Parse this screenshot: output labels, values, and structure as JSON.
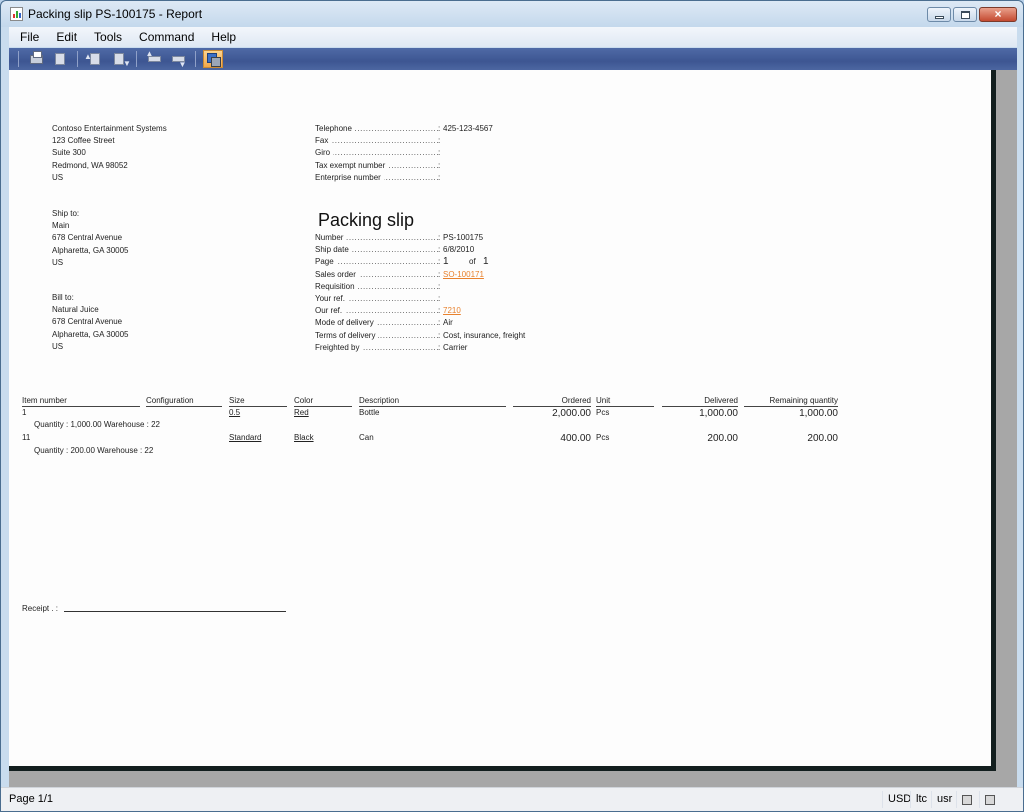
{
  "window": {
    "title": "Packing slip PS-100175 - Report",
    "controls": {
      "minimize": "minimize",
      "maximize": "maximize",
      "close": "×"
    }
  },
  "menubar": {
    "items": [
      "File",
      "Edit",
      "Tools",
      "Command",
      "Help"
    ]
  },
  "toolbar": {
    "buttons": [
      {
        "icon": "printer-icon",
        "tooltip": "Print"
      },
      {
        "icon": "export-icon",
        "tooltip": "Export"
      },
      {
        "icon": "page-up-icon",
        "tooltip": "Previous"
      },
      {
        "icon": "page-down-icon",
        "tooltip": "Next"
      },
      {
        "icon": "first-page-icon",
        "tooltip": "First"
      },
      {
        "icon": "last-page-icon",
        "tooltip": "Last"
      },
      {
        "icon": "view-toggle-icon",
        "tooltip": "Toggle view",
        "active": true
      }
    ]
  },
  "report": {
    "company": {
      "lines": [
        "Contoso Entertainment Systems",
        "123 Coffee Street",
        "Suite 300",
        "Redmond, WA 98052",
        "US"
      ]
    },
    "contact": [
      {
        "label": "Telephone",
        "value": "425-123-4567"
      },
      {
        "label": "Fax",
        "value": ""
      },
      {
        "label": "Giro",
        "value": ""
      },
      {
        "label": "Tax exempt number",
        "value": ""
      },
      {
        "label": "Enterprise number",
        "value": ""
      }
    ],
    "ship_to": {
      "lines": [
        "Ship to:",
        "Main",
        "678 Central Avenue",
        "Alpharetta, GA 30005",
        "US"
      ]
    },
    "bill_to": {
      "lines": [
        "Bill to:",
        "Natural Juice",
        "678 Central Avenue",
        "Alpharetta, GA 30005",
        "US"
      ]
    },
    "title": "Packing slip",
    "details": [
      {
        "label": "Number",
        "value": "PS-100175"
      },
      {
        "label": "Ship date",
        "value": "6/8/2010"
      },
      {
        "label": "Page",
        "value": "1",
        "of_label": "of",
        "of_value": "1"
      },
      {
        "label": "Sales order",
        "value": "SO-100171",
        "link": true
      },
      {
        "label": "Requisition",
        "value": ""
      },
      {
        "label": "Your ref.",
        "value": ""
      },
      {
        "label": "Our ref.",
        "value": "7210",
        "link": true
      },
      {
        "label": "Mode of delivery",
        "value": "Air"
      },
      {
        "label": "Terms of delivery",
        "value": "Cost, insurance, freight"
      },
      {
        "label": "Freighted by",
        "value": "Carrier"
      }
    ],
    "dots": "................................................",
    "colon": ":",
    "table": {
      "headers": {
        "item_number": "Item number",
        "configuration": "Configuration",
        "size": "Size",
        "color": "Color",
        "description": "Description",
        "ordered": "Ordered",
        "unit": "Unit",
        "delivered": "Delivered",
        "remaining": "Remaining quantity"
      },
      "rows": [
        {
          "item_number": "1",
          "configuration": "",
          "size": "0.5",
          "color": "Red",
          "description": "Bottle",
          "ordered": "2,000.00",
          "unit": "Pcs",
          "delivered": "1,000.00",
          "remaining": "1,000.00",
          "sub": "Quantity : 1,000.00  Warehouse : 22"
        },
        {
          "item_number": "11",
          "configuration": "",
          "size": "Standard",
          "color": "Black",
          "description": "Can",
          "ordered": "400.00",
          "unit": "Pcs",
          "delivered": "200.00",
          "remaining": "200.00",
          "sub": "Quantity : 200.00  Warehouse : 22"
        }
      ]
    },
    "receipt_label": "Receipt  . :"
  },
  "statusbar": {
    "page": "Page 1/1",
    "currency": "USD",
    "company": "ltc",
    "user": "usr"
  },
  "colors": {
    "link": "#e8822e",
    "toolbar": "#3d5692",
    "active_button": "#f2a74b"
  }
}
